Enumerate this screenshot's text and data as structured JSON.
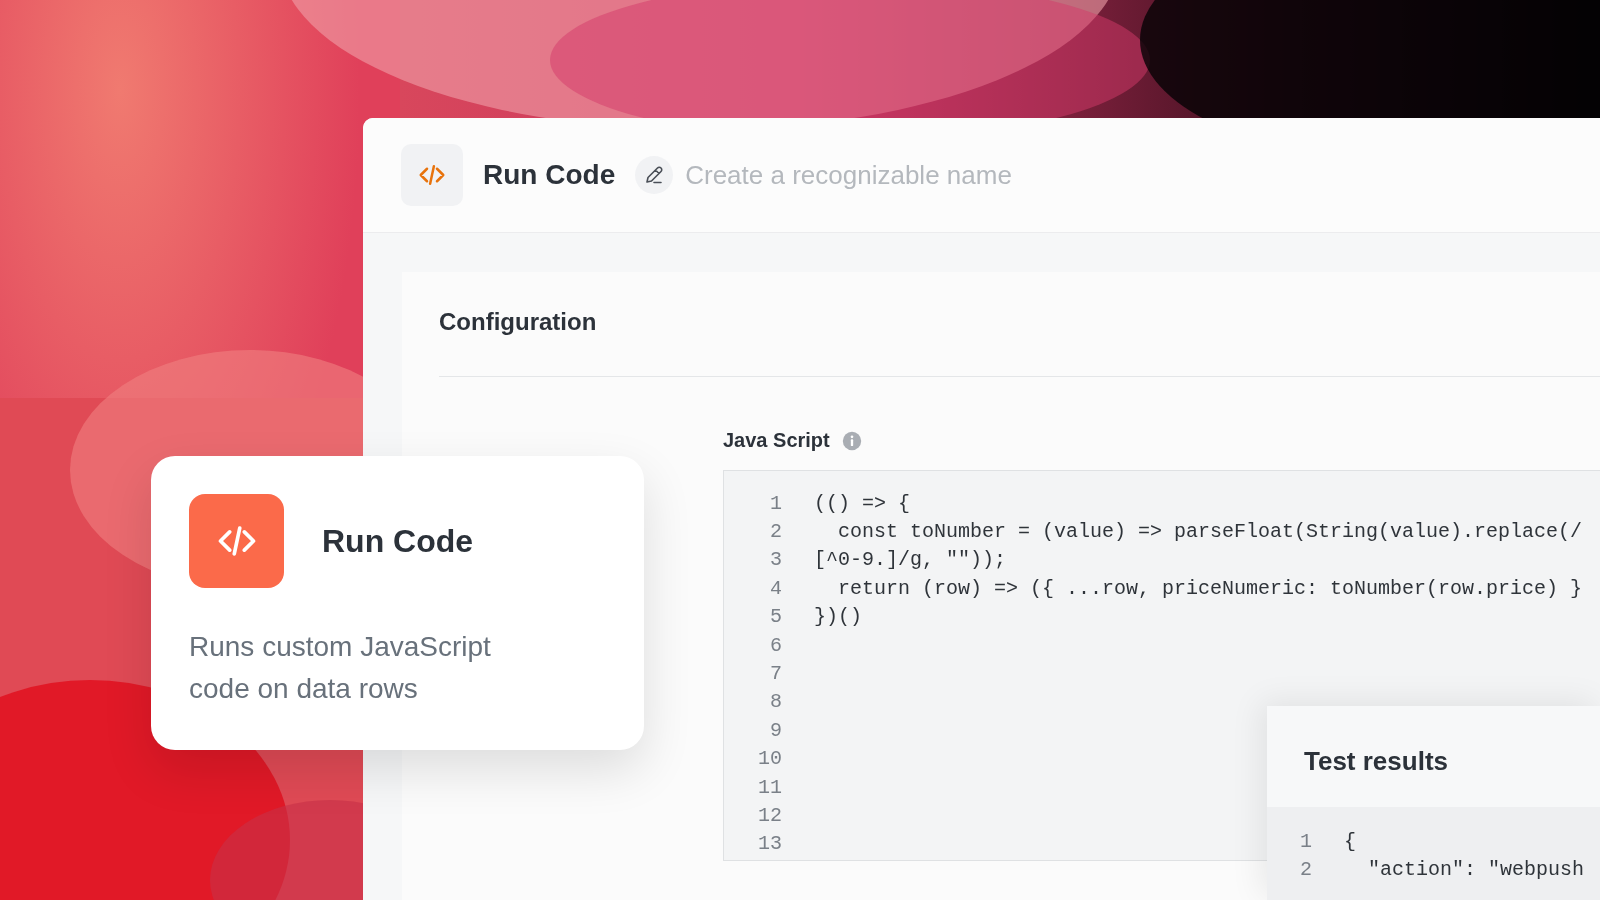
{
  "window": {
    "title": "Run Code",
    "name_field": {
      "placeholder": "Create a recognizable name"
    }
  },
  "configuration": {
    "title": "Configuration",
    "editor": {
      "label": "Java Script",
      "lines": [
        {
          "number": "1",
          "text": "(() => {"
        },
        {
          "number": "2",
          "text": "  const toNumber = (value) => parseFloat(String(value).replace(/"
        },
        {
          "number": "3",
          "text": "[^0-9.]/g, \"\"));"
        },
        {
          "number": "4",
          "text": "  return (row) => ({ ...row, priceNumeric: toNumber(row.price) }"
        },
        {
          "number": "5",
          "text": "})()"
        },
        {
          "number": "6"
        },
        {
          "number": "7"
        },
        {
          "number": "8"
        },
        {
          "number": "9"
        },
        {
          "number": "10"
        },
        {
          "number": "11"
        },
        {
          "number": "12"
        },
        {
          "number": "13"
        }
      ]
    }
  },
  "test_results": {
    "title": "Test results",
    "lines": [
      {
        "number": "1",
        "text": "{"
      },
      {
        "number": "2",
        "text": "  \"action\": \"webpush"
      }
    ]
  },
  "node_card": {
    "title": "Run Code",
    "description": "Runs custom JavaScript code on data rows"
  }
}
